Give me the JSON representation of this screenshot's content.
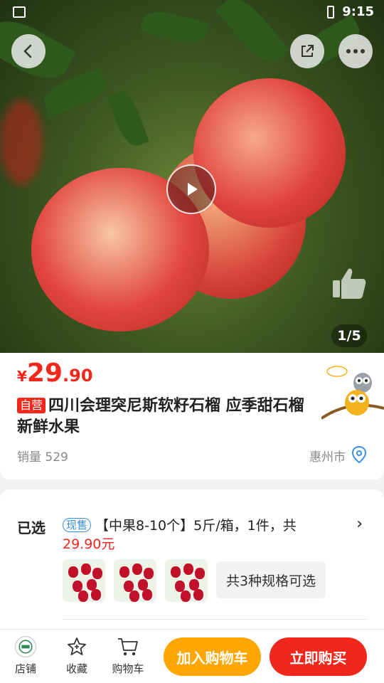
{
  "status_bar": {
    "time": "9:15"
  },
  "gallery": {
    "counter": "1/5"
  },
  "product": {
    "currency": "¥",
    "price_int": "29",
    "price_dec": ".90",
    "self_tag": "自营",
    "title": "四川会理突尼斯软籽石榴 应季甜石榴新鲜水果",
    "sales_label": "销量",
    "sales_count": "529",
    "city": "惠州市"
  },
  "selection": {
    "label": "已选",
    "stock_tag": "现售",
    "spec_text": "【中果8-10个】5斤/箱，1件，共",
    "spec_price": "29.90元",
    "spec_count_label": "共3种规格可选"
  },
  "bottom_bar": {
    "store": "店铺",
    "favorite": "收藏",
    "cart": "购物车",
    "add_to_cart": "加入购物车",
    "buy_now": "立即购买"
  },
  "colors": {
    "accent_red": "#f2271c",
    "accent_orange": "#ffa600",
    "tag_blue": "#3a8ee6"
  }
}
